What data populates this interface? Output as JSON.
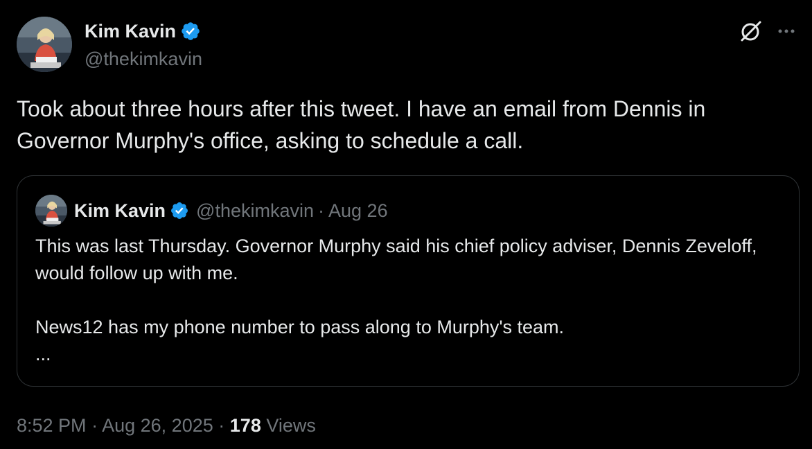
{
  "author": {
    "name": "Kim Kavin",
    "handle": "@thekimkavin",
    "verified": true,
    "avatar": "profile-photo"
  },
  "tweet": {
    "text": "Took about three hours after this tweet. I have an email from Dennis in Governor Murphy's office, asking to schedule a call."
  },
  "quote": {
    "name": "Kim Kavin",
    "handle": "@thekimkavin",
    "separator": "·",
    "date": "Aug 26",
    "paragraph1": "This was last Thursday. Governor Murphy said his chief policy adviser, Dennis Zeveloff, would follow up with me.",
    "paragraph2": "News12 has my phone number to pass along to Murphy's team.",
    "truncation": "..."
  },
  "meta": {
    "time": "8:52 PM",
    "separator1": "·",
    "date": "Aug 26, 2025",
    "separator2": "·",
    "views_count": "178",
    "views_label": "Views"
  },
  "icons": {
    "grok": "grok-icon",
    "more": "more-options-icon",
    "verified": "verified-badge-icon"
  },
  "colors": {
    "background": "#000000",
    "text": "#e7e9ea",
    "secondary": "#71767b",
    "verified": "#1d9bf0",
    "border": "#2f3336"
  }
}
